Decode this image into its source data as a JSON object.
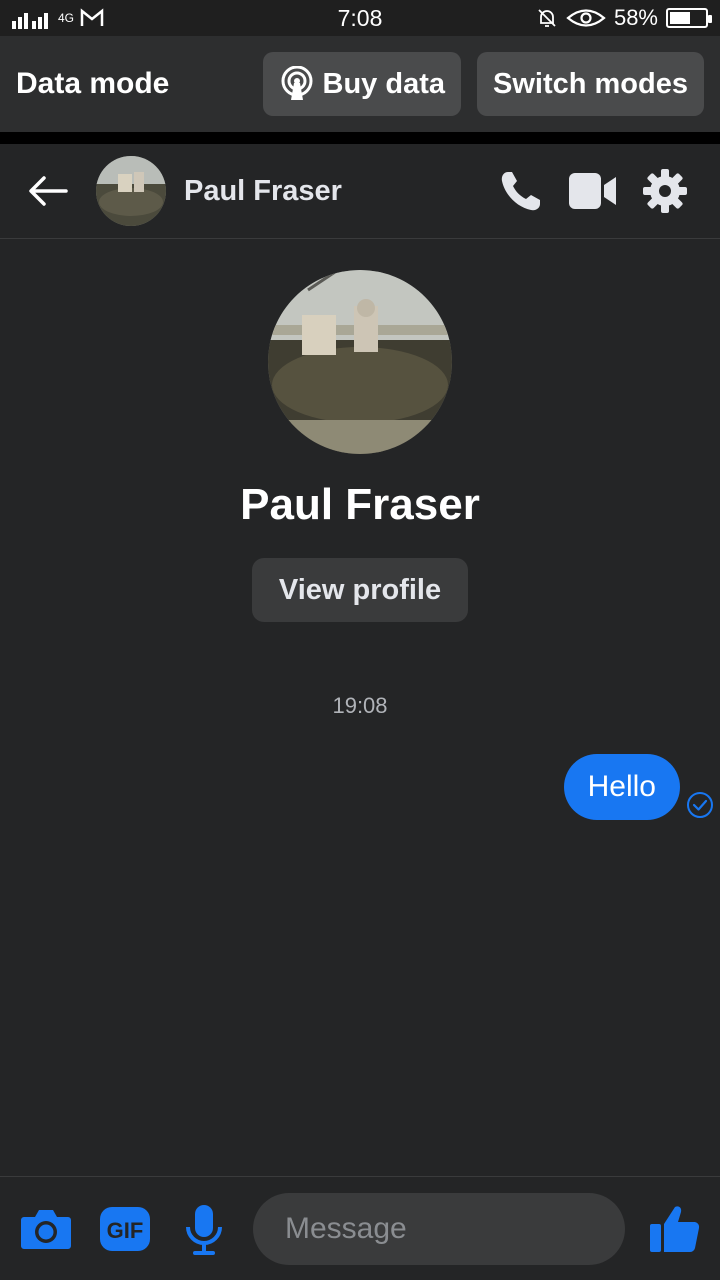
{
  "status": {
    "time": "7:08",
    "battery": "58%",
    "battery_level": 0.58,
    "network": "4G"
  },
  "data_mode": {
    "title": "Data mode",
    "buy_label": "Buy data",
    "switch_label": "Switch modes"
  },
  "header": {
    "name": "Paul Fraser"
  },
  "profile": {
    "name": "Paul Fraser",
    "view_label": "View profile"
  },
  "conversation": {
    "timestamp": "19:08",
    "messages": [
      {
        "text": "Hello",
        "from": "me",
        "status": "sent"
      }
    ]
  },
  "composer": {
    "placeholder": "Message",
    "gif_label": "GIF"
  },
  "colors": {
    "accent": "#1877f2",
    "background": "#242526",
    "surface": "#3a3b3c"
  }
}
